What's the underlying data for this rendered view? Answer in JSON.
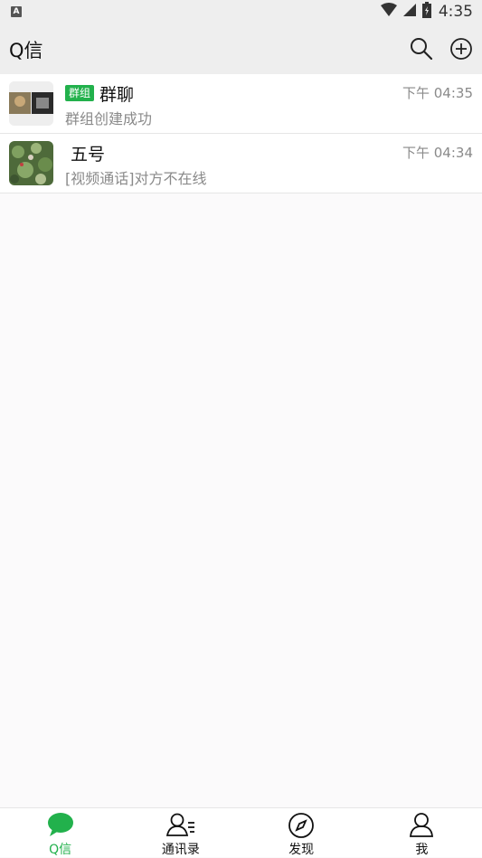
{
  "status_bar": {
    "indicator": "A",
    "time": "4:35",
    "icons": [
      "wifi-icon",
      "signal-icon",
      "battery-icon"
    ]
  },
  "header": {
    "title": "Q信",
    "actions": [
      "search-icon",
      "plus-circle-icon"
    ]
  },
  "chats": [
    {
      "badge": "群组",
      "name": "群聊",
      "last_message": "群组创建成功",
      "time": "下午 04:35"
    },
    {
      "badge": "",
      "name": "五号",
      "last_message": "[视频通话]对方不在线",
      "time": "下午 04:34"
    }
  ],
  "tabs": [
    {
      "label": "Q信",
      "icon": "chat-bubble-icon",
      "active": true
    },
    {
      "label": "通讯录",
      "icon": "contacts-icon",
      "active": false
    },
    {
      "label": "发现",
      "icon": "compass-icon",
      "active": false
    },
    {
      "label": "我",
      "icon": "person-icon",
      "active": false
    }
  ],
  "colors": {
    "accent": "#22b14c",
    "bar_bg": "#eeeeee",
    "secondary_text": "#8a8a8a"
  }
}
